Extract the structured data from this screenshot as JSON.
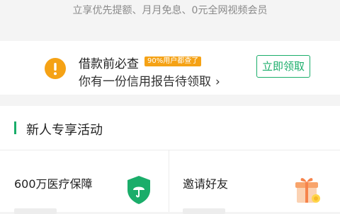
{
  "banner": {
    "subtitle": "立享优先提额、月月免息、0元全网视频会员"
  },
  "credit_notice": {
    "title": "借款前必查",
    "tag": "90%用户都查了",
    "subtitle": "你有一份信用报告待领取",
    "chevron": "›",
    "claim_label": "立即领取"
  },
  "new_user": {
    "section_title": "新人专享活动",
    "tiles": [
      {
        "label": "600万医疗保障",
        "icon": "shield-umbrella-icon"
      },
      {
        "label": "邀请好友",
        "icon": "gift-box-icon"
      }
    ]
  },
  "colors": {
    "accent": "#1aad6a",
    "warning": "#f5a215",
    "gift": "#f8a46b"
  }
}
